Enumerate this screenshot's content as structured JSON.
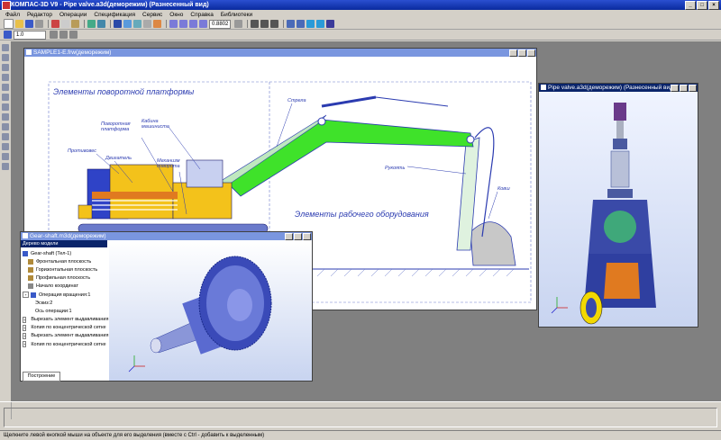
{
  "window": {
    "title": "КОМПАС-3D V9 - Pipe valve.a3d(деморежим) (Разнесенный вид)"
  },
  "menu": [
    "Файл",
    "Редактор",
    "Операции",
    "Спецификация",
    "Сервис",
    "Окно",
    "Справка",
    "Библиотеки"
  ],
  "toolbar": {
    "scale_value": "1.0",
    "zoom_value": "0.8802"
  },
  "drawing_window": {
    "title": "SAMPLE1-E.frw(деморежим)",
    "heading_platform": "Элементы поворотной платформы",
    "heading_equipment": "Элементы рабочего оборудования",
    "labels": {
      "platform": "Поворотная платформа",
      "cabin": "Кабина машиниста",
      "counterweight": "Противовес",
      "engine": "Двигатель",
      "swing_mechanism": "Механизм поворота",
      "boom": "Стрела",
      "stick": "Рукоять",
      "bucket": "Ковш"
    }
  },
  "valve_window": {
    "title": "Pipe valve.a3d(деморежим) (Разнесенный вид)"
  },
  "gear_window": {
    "title": "Gear-shaft.m3d(деморежим)",
    "tree_header": "Дерево модели",
    "tree_items": [
      "Gear-shaft (Тел-1)",
      "Фронтальная плоскость",
      "Горизонтальная плоскость",
      "Профильная плоскость",
      "Начало координат",
      "Операция вращения:1",
      "Эскиз:2",
      "Ось операции:1",
      "Вырезать элемент выдавливания",
      "Копия по концентрической сетке",
      "Вырезать элемент выдавливания",
      "Копия по концентрической сетке"
    ],
    "tab": "Построение"
  },
  "status": "Щелкните левой кнопкой мыши на объекте для его выделения (вместе с Ctrl - добавить к выделенным)",
  "colors": {
    "title_active": "#0a246a",
    "title_inactive": "#7a96df",
    "boom_green": "#3fe22a",
    "machine_yellow": "#f3c21b",
    "machine_blue": "#2f43c7"
  }
}
